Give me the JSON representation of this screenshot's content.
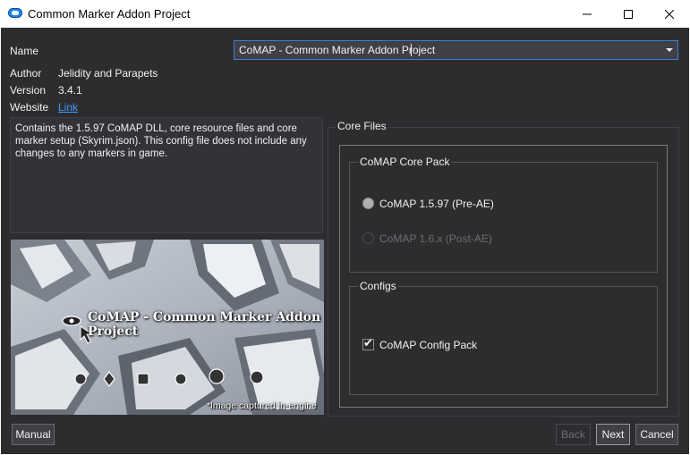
{
  "window": {
    "title": "Common Marker Addon Project",
    "icon": "app-icon",
    "controls": [
      "minimize-icon",
      "maximize-icon",
      "close-icon"
    ]
  },
  "info": {
    "name_label": "Name",
    "name_value": "CoMAP - Common Marker Addon Project",
    "author_label": "Author",
    "author_value": "Jelidity and Parapets",
    "version_label": "Version",
    "version_value": "3.4.1",
    "website_label": "Website",
    "website_link": "Link"
  },
  "description": "Contains the 1.5.97 CoMAP DLL, core resource files and core marker setup (Skyrim.json). This config file does not include any changes to any markers in game.",
  "preview": {
    "overlay_title": "CoMAP - Common Marker Addon Project",
    "caption": "*Image captured in-engine"
  },
  "core_files": {
    "title": "Core Files",
    "core_pack": {
      "title": "CoMAP Core Pack",
      "options": [
        {
          "label": "CoMAP 1.5.97 (Pre-AE)",
          "selected": true,
          "enabled": true
        },
        {
          "label": "CoMAP 1.6.x (Post-AE)",
          "selected": false,
          "enabled": false
        }
      ]
    },
    "configs": {
      "title": "Configs",
      "checkbox_label": "CoMAP Config Pack",
      "checked": true
    }
  },
  "buttons": {
    "manual": "Manual",
    "back": "Back",
    "next": "Next",
    "cancel": "Cancel"
  },
  "colors": {
    "background": "#2d2d30",
    "accent": "#3d7fd0",
    "link": "#3f9cff"
  }
}
